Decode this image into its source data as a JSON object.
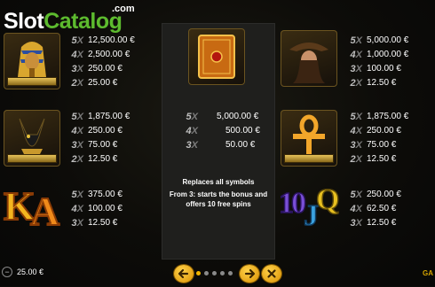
{
  "watermark": {
    "brand_part1": "Slot",
    "brand_part2": "Catalog",
    "tld": ".com"
  },
  "paytable": {
    "left_top": {
      "name": "pharaoh",
      "rows": [
        [
          "5",
          "X",
          "12,500.00 €"
        ],
        [
          "4",
          "X",
          "2,500.00 €"
        ],
        [
          "3",
          "X",
          "250.00 €"
        ],
        [
          "2",
          "X",
          "25.00 €"
        ]
      ]
    },
    "left_middle": {
      "name": "anubis",
      "rows": [
        [
          "5",
          "X",
          "1,875.00 €"
        ],
        [
          "4",
          "X",
          "250.00 €"
        ],
        [
          "3",
          "X",
          "75.00 €"
        ],
        [
          "2",
          "X",
          "12.50 €"
        ]
      ]
    },
    "left_bottom": {
      "name": "K-A",
      "rows": [
        [
          "5",
          "X",
          "375.00 €"
        ],
        [
          "4",
          "X",
          "100.00 €"
        ],
        [
          "3",
          "X",
          "12.50 €"
        ]
      ]
    },
    "right_top": {
      "name": "explorer",
      "rows": [
        [
          "5",
          "X",
          "5,000.00 €"
        ],
        [
          "4",
          "X",
          "1,000.00 €"
        ],
        [
          "3",
          "X",
          "100.00 €"
        ],
        [
          "2",
          "X",
          "12.50 €"
        ]
      ]
    },
    "right_middle": {
      "name": "ankh",
      "rows": [
        [
          "5",
          "X",
          "1,875.00 €"
        ],
        [
          "4",
          "X",
          "250.00 €"
        ],
        [
          "3",
          "X",
          "75.00 €"
        ],
        [
          "2",
          "X",
          "12.50 €"
        ]
      ]
    },
    "right_bottom": {
      "name": "10-J-Q",
      "rows": [
        [
          "5",
          "X",
          "250.00 €"
        ],
        [
          "4",
          "X",
          "62.50 €"
        ],
        [
          "3",
          "X",
          "12.50 €"
        ]
      ]
    }
  },
  "center_panel": {
    "symbol": "book-scatter",
    "rows": [
      [
        "5",
        "X",
        "5,000.00 €"
      ],
      [
        "4",
        "X",
        "500.00 €"
      ],
      [
        "3",
        "X",
        "50.00 €"
      ]
    ],
    "desc_title": "Replaces all symbols",
    "desc_line1": "From 3: starts the bonus and",
    "desc_line2": "offers 10 free spins"
  },
  "letters": {
    "ka": [
      "K",
      "A"
    ],
    "tjq": [
      "1",
      "0",
      "J",
      "Q"
    ]
  },
  "footer": {
    "bet_value": "25.00 €",
    "pages": 5,
    "current_page": 1,
    "corner_text": "GA"
  },
  "colors": {
    "accent": "#f0b400",
    "multiplier": "#7c7c7c",
    "panel": "#1f1f1d"
  }
}
